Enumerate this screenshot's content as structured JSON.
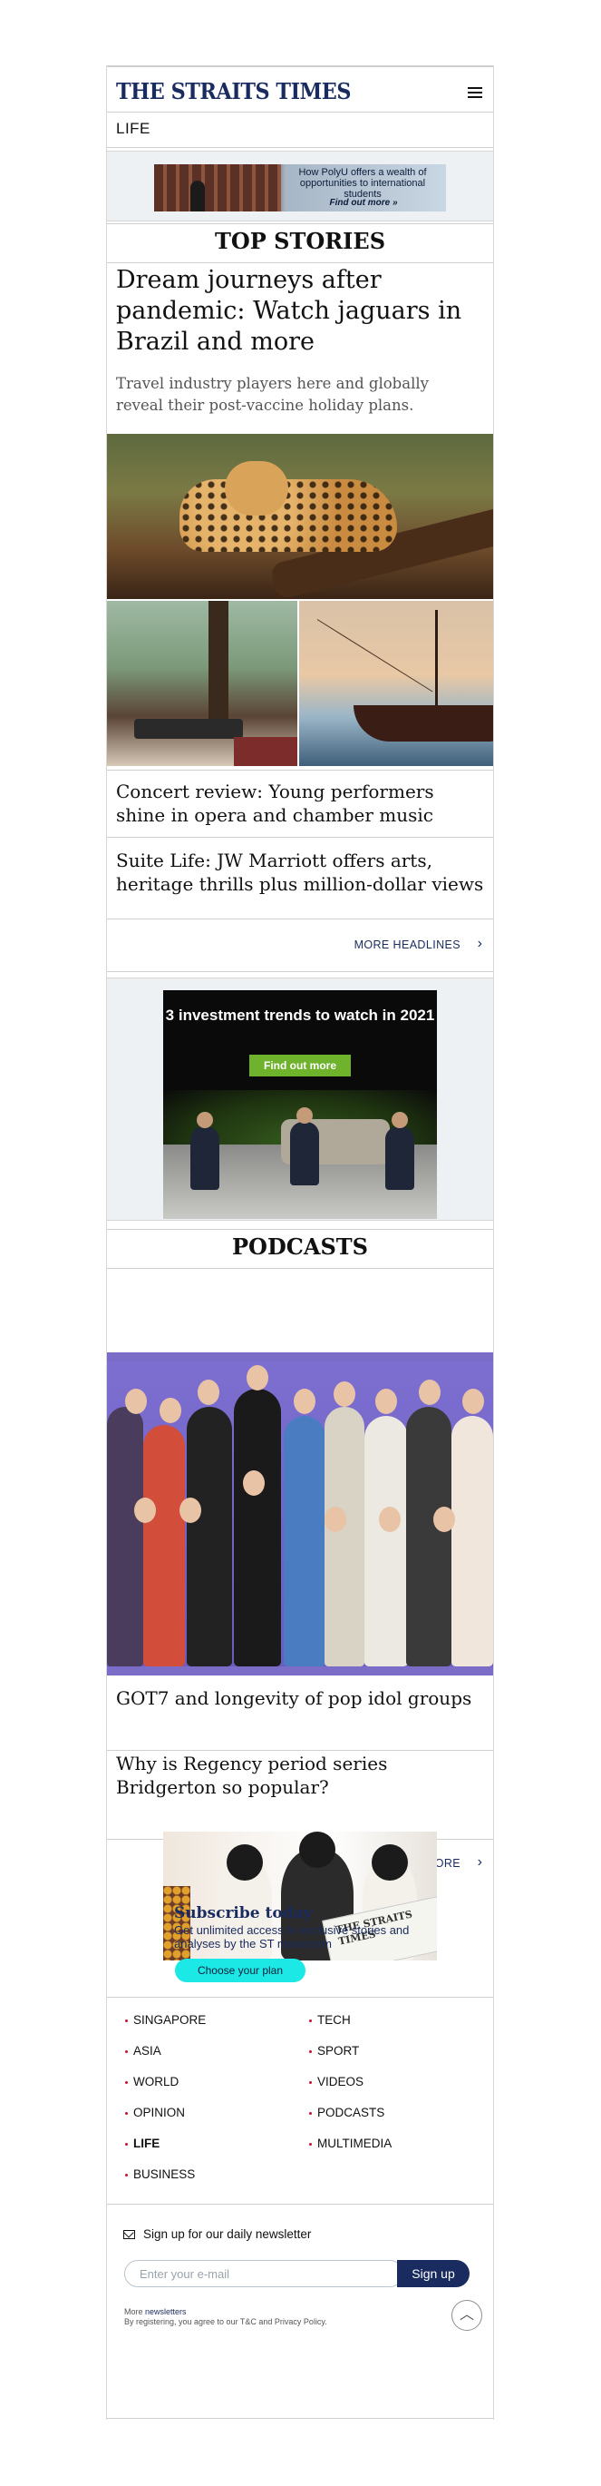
{
  "header": {
    "logo": "THE STRAITS TIMES",
    "section": "LIFE"
  },
  "ad_top": {
    "text": "How PolyU offers a wealth of opportunities to international students",
    "cta": "Find out more »"
  },
  "top_stories": {
    "heading": "TOP STORIES",
    "lead": {
      "title": "Dream journeys after pandemic: Watch jaguars in Brazil and more",
      "summary": "Travel industry players here and globally reveal their post-vaccine holiday plans."
    },
    "headlines": [
      "Concert review: Young performers shine in opera and chamber music",
      "Suite Life: JW Marriott offers arts, heritage thrills plus million-dollar views"
    ],
    "more_label": "MORE HEADLINES"
  },
  "ad_mid": {
    "title": "3 investment trends to watch in 2021",
    "cta": "Find out more"
  },
  "podcasts": {
    "heading": "PODCASTS",
    "items": [
      "GOT7 and longevity of pop idol groups",
      "Why is Regency period series Bridgerton so popular?"
    ],
    "more_label": "MORE"
  },
  "subscribe": {
    "paper_label": "THE STRAITS TIMES",
    "title": "Subscribe today",
    "text": "Get unlimited access to exclusive stories and analyses by the ST newsroom",
    "cta": "Choose your plan"
  },
  "footer_nav": {
    "left": [
      "SINGAPORE",
      "ASIA",
      "WORLD",
      "OPINION",
      "LIFE",
      "BUSINESS"
    ],
    "right": [
      "TECH",
      "SPORT",
      "VIDEOS",
      "PODCASTS",
      "MULTIMEDIA"
    ],
    "active": "LIFE"
  },
  "newsletter": {
    "label": "Sign up for our daily newsletter",
    "placeholder": "Enter your e-mail",
    "button": "Sign up",
    "more_prefix": "More",
    "more_link": "newsletters",
    "disclaimer": "By registering, you agree to our T&C and Privacy Policy."
  },
  "colors": {
    "brand_navy": "#1a2b5f",
    "accent_red": "#c8102e",
    "cta_cyan": "#1ce8e5",
    "ad_green": "#6fb22c"
  },
  "icons": {
    "menu": "hamburger-icon",
    "chevron": "chevron-right-icon",
    "mail": "mail-icon",
    "back_to_top": "arrow-up-icon"
  }
}
